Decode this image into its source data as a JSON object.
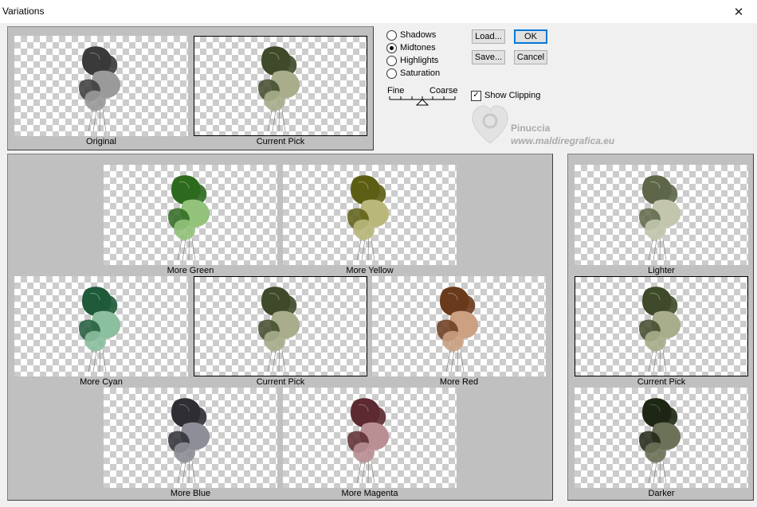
{
  "window": {
    "title": "Variations",
    "close_icon": "close-icon"
  },
  "tone_options": [
    {
      "label": "Shadows",
      "selected": false
    },
    {
      "label": "Midtones",
      "selected": true
    },
    {
      "label": "Highlights",
      "selected": false
    },
    {
      "label": "Saturation",
      "selected": false
    }
  ],
  "slider": {
    "fine_label": "Fine",
    "coarse_label": "Coarse"
  },
  "buttons": {
    "load": "Load...",
    "ok": "OK",
    "save": "Save...",
    "cancel": "Cancel"
  },
  "show_clipping": {
    "label": "Show Clipping",
    "checked": true
  },
  "watermark": {
    "line1": "Pinuccia",
    "line2": "www.maldiregrafica.eu"
  },
  "top_thumbs": [
    {
      "label": "Original",
      "colors": [
        "#3a3a3a",
        "#9a9a9a"
      ]
    },
    {
      "label": "Current Pick",
      "colors": [
        "#3f4a2a",
        "#a9ad8c"
      ]
    }
  ],
  "color_thumbs": [
    {
      "label": "More Green",
      "colors": [
        "#2e6a1e",
        "#93c27a"
      ]
    },
    {
      "label": "More Yellow",
      "colors": [
        "#5c5e14",
        "#b9b77a"
      ]
    },
    {
      "label": "More Cyan",
      "colors": [
        "#1f5a3a",
        "#8cbf9e"
      ]
    },
    {
      "label": "Current Pick",
      "colors": [
        "#3f4a2a",
        "#a9ad8c"
      ]
    },
    {
      "label": "More Red",
      "colors": [
        "#6a3a1c",
        "#cba182"
      ]
    },
    {
      "label": "More Blue",
      "colors": [
        "#2e2e34",
        "#8e8e98"
      ]
    },
    {
      "label": "More Magenta",
      "colors": [
        "#5c2a30",
        "#b98f94"
      ]
    }
  ],
  "brightness_thumbs": [
    {
      "label": "Lighter",
      "colors": [
        "#5d6648",
        "#c3c6ad"
      ]
    },
    {
      "label": "Current Pick",
      "colors": [
        "#3f4a2a",
        "#a9ad8c"
      ]
    },
    {
      "label": "Darker",
      "colors": [
        "#1e2614",
        "#6c7258"
      ]
    }
  ]
}
